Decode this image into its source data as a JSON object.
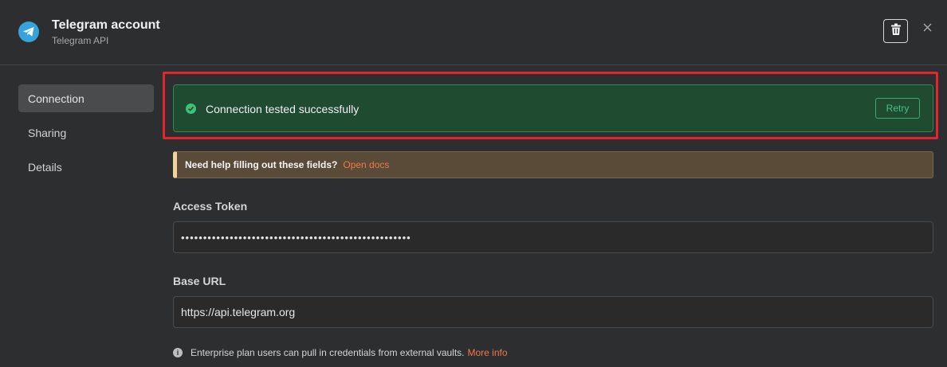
{
  "header": {
    "title": "Telegram account",
    "subtitle": "Telegram API",
    "icons": {
      "logo": "telegram-icon",
      "delete": "trash-icon",
      "close": "close-icon"
    }
  },
  "sidebar": {
    "items": [
      {
        "label": "Connection",
        "active": true
      },
      {
        "label": "Sharing",
        "active": false
      },
      {
        "label": "Details",
        "active": false
      }
    ]
  },
  "status": {
    "message": "Connection tested successfully",
    "retry_label": "Retry",
    "icon": "check-circle-icon"
  },
  "help": {
    "text": "Need help filling out these fields?",
    "link": "Open docs"
  },
  "fields": {
    "access_token": {
      "label": "Access Token",
      "value": "••••••••••••••••••••••••••••••••••••••••••••••••••••"
    },
    "base_url": {
      "label": "Base URL",
      "value": "https://api.telegram.org"
    }
  },
  "info": {
    "text": "Enterprise plan users can pull in credentials from external vaults.",
    "link": "More info",
    "icon": "info-icon"
  },
  "colors": {
    "success_bg": "#1f4b31",
    "success_accent": "#3ec27a",
    "highlight_border": "#e3262b",
    "link": "#f2784b",
    "telegram_blue": "#37a3dd"
  }
}
